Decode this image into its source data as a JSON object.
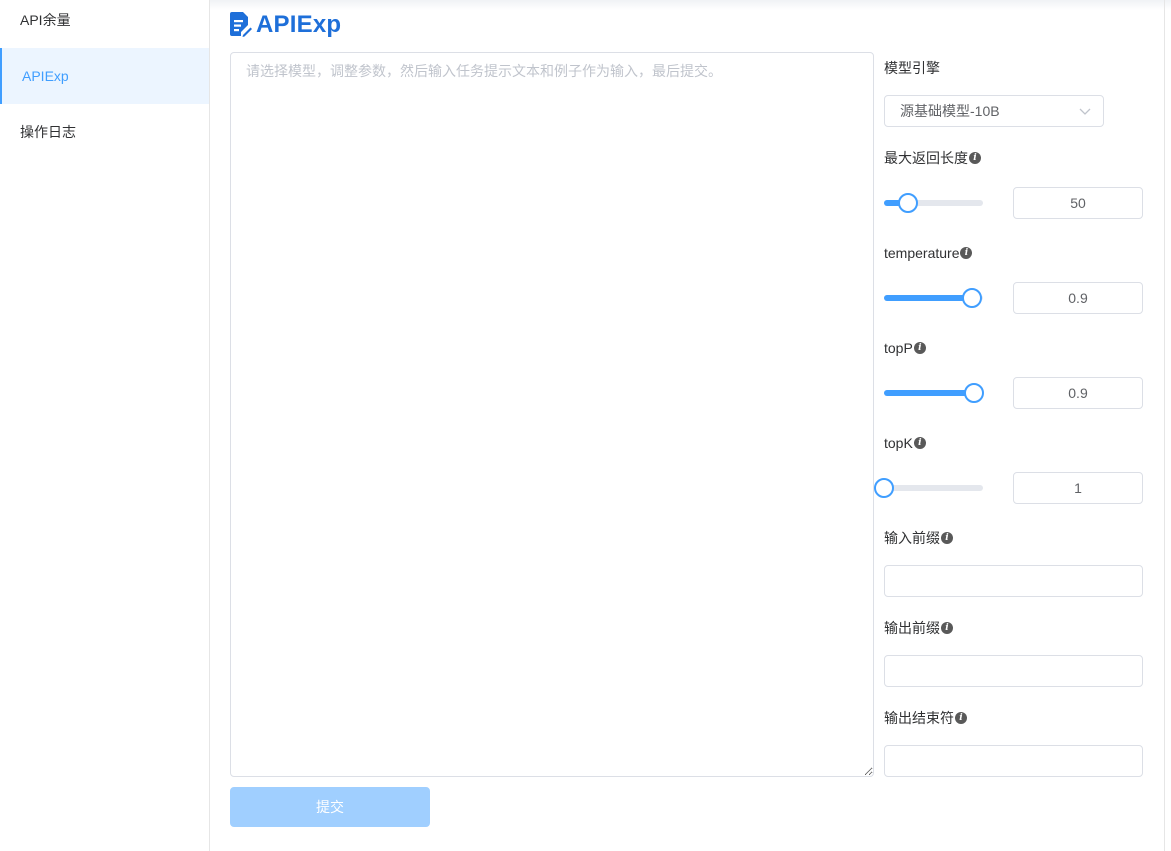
{
  "sidebar": {
    "items": [
      {
        "label": "API余量"
      },
      {
        "label": "APIExp"
      },
      {
        "label": "操作日志"
      }
    ]
  },
  "header": {
    "title": "APIExp"
  },
  "prompt": {
    "placeholder": "请选择模型，调整参数，然后输入任务提示文本和例子作为输入，最后提交。",
    "value": ""
  },
  "submit_label": "提交",
  "params": {
    "engine": {
      "label": "模型引擎",
      "value": "源基础模型-10B"
    },
    "max_length": {
      "label": "最大返回长度",
      "value": "50",
      "slider_fraction": 0.24
    },
    "temperature": {
      "label": "temperature",
      "value": "0.9",
      "slider_fraction": 0.89
    },
    "topP": {
      "label": "topP",
      "value": "0.9",
      "slider_fraction": 0.91
    },
    "topK": {
      "label": "topK",
      "value": "1",
      "slider_fraction": 0.0
    },
    "input_prefix": {
      "label": "输入前缀",
      "value": ""
    },
    "output_prefix": {
      "label": "输出前缀",
      "value": ""
    },
    "output_end": {
      "label": "输出结束符",
      "value": ""
    }
  },
  "colors": {
    "accent": "#409eff",
    "title": "#1e6fd9",
    "active_bg": "#ecf5ff",
    "disabled_button": "#a0cfff"
  },
  "icons": {
    "info": "info-icon",
    "title": "document-edit-icon",
    "select": "chevron-down-icon"
  }
}
